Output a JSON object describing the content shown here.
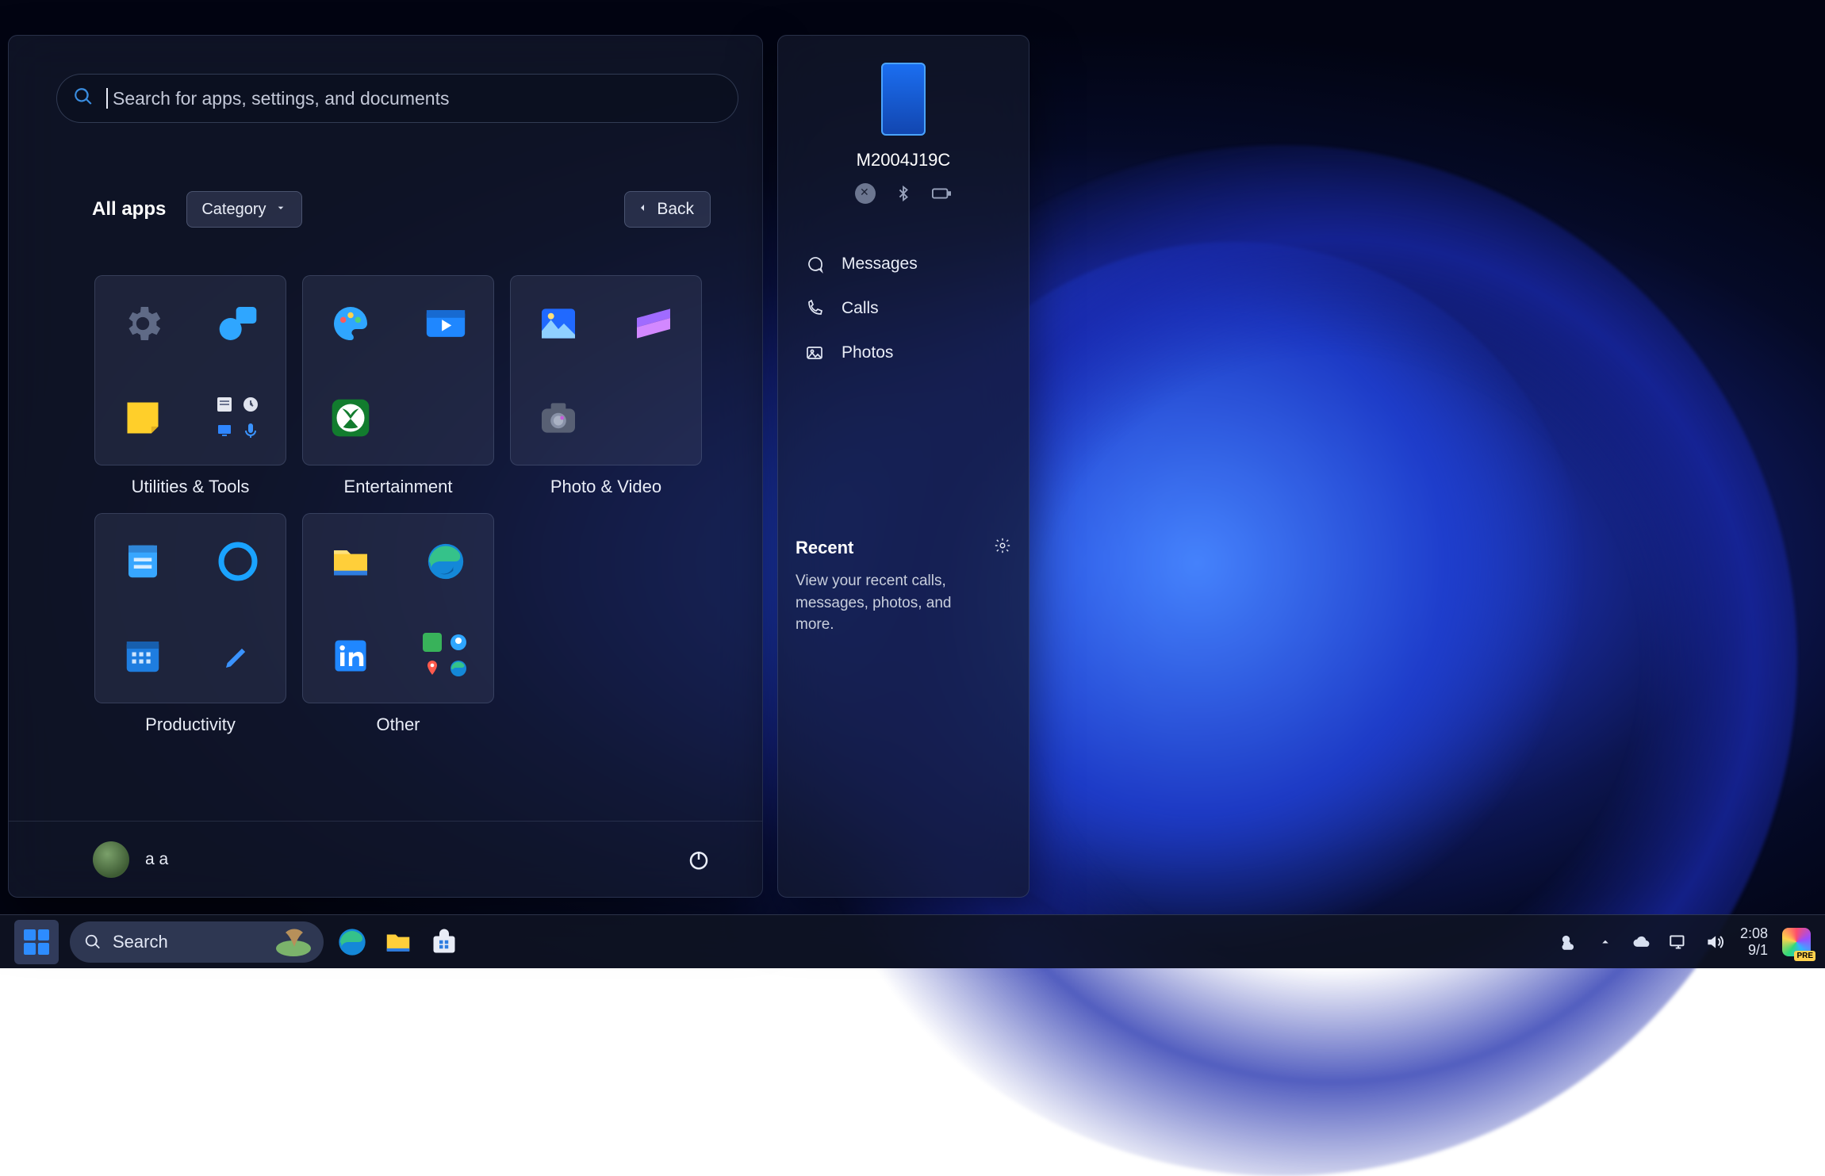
{
  "start": {
    "search_placeholder": "Search for apps, settings, and documents",
    "header": {
      "title": "All apps",
      "dropdown": "Category",
      "back": "Back"
    },
    "categories": [
      {
        "label": "Utilities & Tools"
      },
      {
        "label": "Entertainment"
      },
      {
        "label": "Photo & Video"
      },
      {
        "label": "Productivity"
      },
      {
        "label": "Other"
      }
    ],
    "user_name": "a a"
  },
  "phone": {
    "device_name": "M2004J19C",
    "links": [
      {
        "label": "Messages"
      },
      {
        "label": "Calls"
      },
      {
        "label": "Photos"
      }
    ],
    "recent_title": "Recent",
    "recent_text": "View your recent calls, messages, photos, and more."
  },
  "taskbar": {
    "search_label": "Search",
    "time": "2:08",
    "date": "9/1"
  }
}
